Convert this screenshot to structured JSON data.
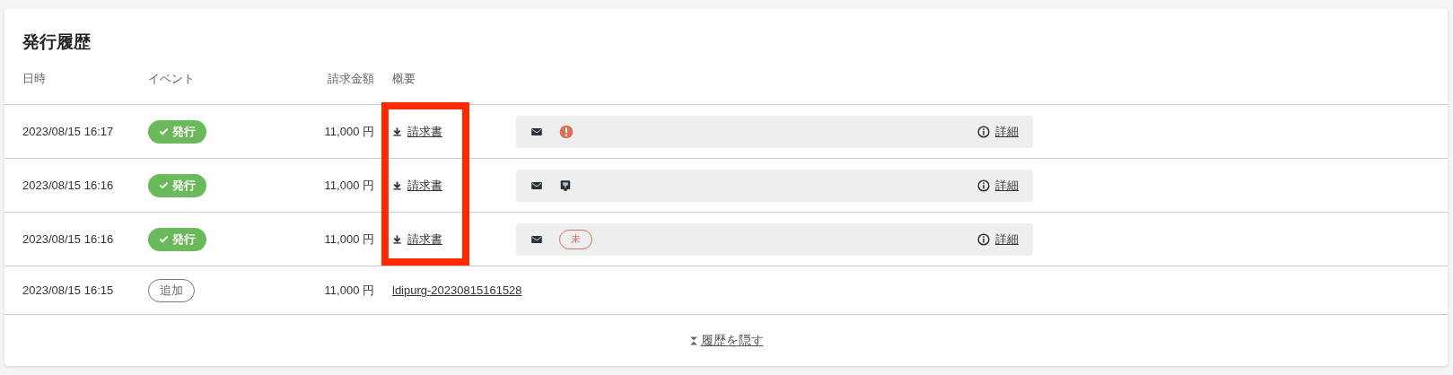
{
  "title": "発行履歴",
  "columns": [
    "日時",
    "イベント",
    "請求金額",
    "概要"
  ],
  "rows": [
    {
      "date": "2023/08/15 16:17",
      "event": {
        "kind": "issued",
        "label": "発行"
      },
      "amount": "11,000 円",
      "summary": {
        "kind": "download",
        "label": "請求書",
        "highlighted": true
      },
      "notice": {
        "status": {
          "kind": "error"
        },
        "detail": "詳細"
      }
    },
    {
      "date": "2023/08/15 16:16",
      "event": {
        "kind": "issued",
        "label": "発行"
      },
      "amount": "11,000 円",
      "summary": {
        "kind": "download",
        "label": "請求書",
        "highlighted": true
      },
      "notice": {
        "status": {
          "kind": "post"
        },
        "detail": "詳細"
      }
    },
    {
      "date": "2023/08/15 16:16",
      "event": {
        "kind": "issued",
        "label": "発行"
      },
      "amount": "11,000 円",
      "summary": {
        "kind": "download",
        "label": "請求書",
        "highlighted": true
      },
      "notice": {
        "status": {
          "kind": "unread",
          "label": "未"
        },
        "detail": "詳細"
      }
    },
    {
      "date": "2023/08/15 16:15",
      "event": {
        "kind": "added",
        "label": "追加"
      },
      "amount": "11,000 円",
      "summary": {
        "kind": "link",
        "label": "ldipurg-20230815161528",
        "highlighted": false
      }
    }
  ],
  "footer_link": "履歴を隠す"
}
